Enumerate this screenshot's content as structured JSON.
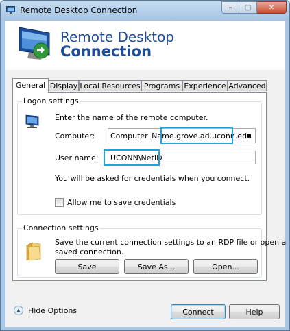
{
  "window": {
    "title": "Remote Desktop Connection",
    "minimize_glyph": "–",
    "maximize_glyph": "□",
    "close_glyph": "✕"
  },
  "header": {
    "line1": "Remote Desktop",
    "line2": "Connection"
  },
  "tabs": [
    {
      "label": "General",
      "active": true
    },
    {
      "label": "Display"
    },
    {
      "label": "Local Resources"
    },
    {
      "label": "Programs"
    },
    {
      "label": "Experience"
    },
    {
      "label": "Advanced"
    }
  ],
  "logon": {
    "group_label": "Logon settings",
    "instruction": "Enter the name of the remote computer.",
    "computer_label": "Computer:",
    "computer_value": "Computer_Name.grove.ad.uconn.edu",
    "username_label": "User name:",
    "username_value": "UCONN\\NetID",
    "credentials_note": "You will be asked for credentials when you connect.",
    "save_credentials_label": "Allow me to save credentials",
    "save_credentials_checked": false
  },
  "connection": {
    "group_label": "Connection settings",
    "description_line1": "Save the current connection settings to an RDP file or open a",
    "description_line2": "saved connection.",
    "save_label": "Save",
    "save_as_label": "Save As...",
    "open_label": "Open..."
  },
  "footer": {
    "hide_options_label": "Hide Options",
    "hide_options_glyph": "▲",
    "connect_label": "Connect",
    "help_label": "Help"
  },
  "colors": {
    "brand_blue": "#1e4c95",
    "highlight": "#1fa3dc",
    "chrome": "#a9c7e6"
  }
}
